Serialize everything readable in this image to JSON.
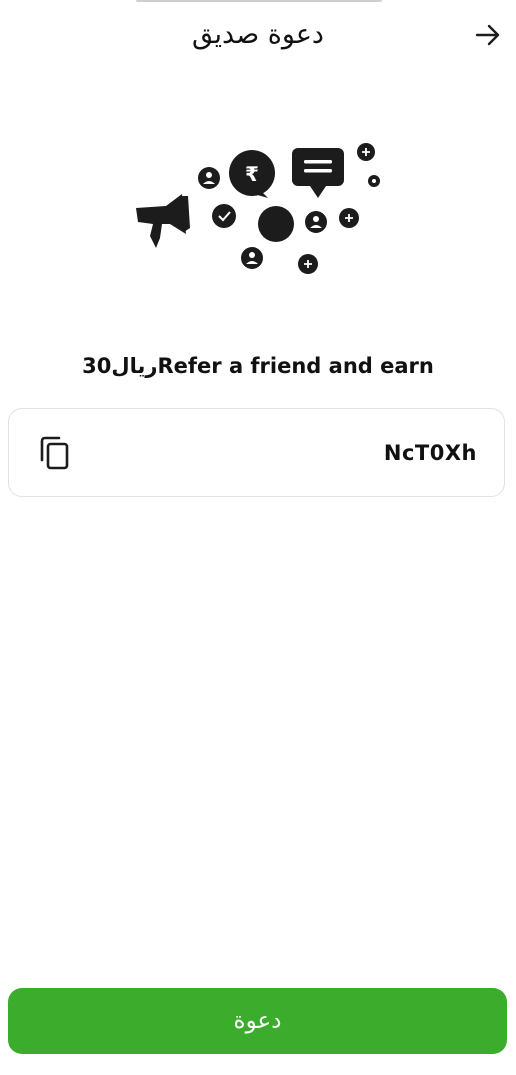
{
  "header": {
    "title": "دعوة صديق",
    "back_icon": "arrow-right-icon"
  },
  "illustration": {
    "icon": "referral-megaphone-illustration",
    "currency_symbol": "₹"
  },
  "referral": {
    "message": "30رياﻝRefer a friend and earn",
    "code": "NcT0Xh",
    "copy_icon": "copy-icon"
  },
  "actions": {
    "invite_label": "دعوة"
  },
  "colors": {
    "accent": "#3cac2d",
    "text": "#111111",
    "icon_dark": "#1c1c1c",
    "card_border": "#e2e2e2"
  }
}
